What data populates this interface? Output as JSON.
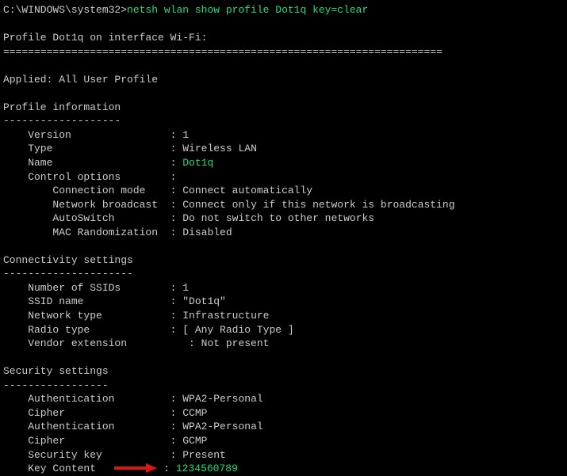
{
  "prompt": {
    "path": "C:\\WINDOWS\\system32>",
    "command": "netsh wlan show profile Dot1q key=clear"
  },
  "header": {
    "title": "Profile Dot1q on interface Wi-Fi:",
    "sep": "======================================================================="
  },
  "applied": "Applied: All User Profile",
  "sections": {
    "profileInfo": {
      "title": "Profile information",
      "dash": "-------------------",
      "rows": {
        "version": {
          "label": "    Version                : ",
          "value": "1"
        },
        "type": {
          "label": "    Type                   : ",
          "value": "Wireless LAN"
        },
        "name": {
          "label": "    Name                   : ",
          "value": "Dot1q"
        },
        "controlOpts": {
          "label": "    Control options        :",
          "value": ""
        },
        "connMode": {
          "label": "        Connection mode    : ",
          "value": "Connect automatically"
        },
        "netBroadcast": {
          "label": "        Network broadcast  : ",
          "value": "Connect only if this network is broadcasting"
        },
        "autoswitch": {
          "label": "        AutoSwitch         : ",
          "value": "Do not switch to other networks"
        },
        "macRandom": {
          "label": "        MAC Randomization  : ",
          "value": "Disabled"
        }
      }
    },
    "connectivity": {
      "title": "Connectivity settings",
      "dash": "---------------------",
      "rows": {
        "numSsids": {
          "label": "    Number of SSIDs        : ",
          "value": "1"
        },
        "ssidName": {
          "label": "    SSID name              : ",
          "value": "\"Dot1q\""
        },
        "netType": {
          "label": "    Network type           : ",
          "value": "Infrastructure"
        },
        "radioType": {
          "label": "    Radio type             : ",
          "value": "[ Any Radio Type ]"
        },
        "vendorExt": {
          "label": "    Vendor extension          : ",
          "value": "Not present"
        }
      }
    },
    "security": {
      "title": "Security settings",
      "dash": "-----------------",
      "rows": {
        "auth1": {
          "label": "    Authentication         : ",
          "value": "WPA2-Personal"
        },
        "cipher1": {
          "label": "    Cipher                 : ",
          "value": "CCMP"
        },
        "auth2": {
          "label": "    Authentication         : ",
          "value": "WPA2-Personal"
        },
        "cipher2": {
          "label": "    Cipher                 : ",
          "value": "GCMP"
        },
        "secKey": {
          "label": "    Security key           : ",
          "value": "Present"
        },
        "keyContent": {
          "label": "    Key Content",
          "sep": ": ",
          "value": "1234560789"
        }
      }
    }
  }
}
